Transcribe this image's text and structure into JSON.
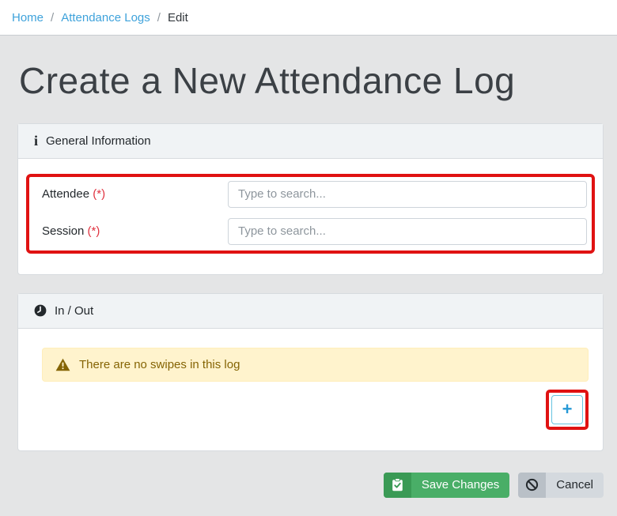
{
  "breadcrumb": {
    "home": "Home",
    "section": "Attendance Logs",
    "current": "Edit",
    "separator": "/"
  },
  "page": {
    "title": "Create a New Attendance Log"
  },
  "general_card": {
    "title": "General Information",
    "info_icon_glyph": "i",
    "fields": [
      {
        "label": "Attendee",
        "required_mark": "(*)",
        "placeholder": "Type to search...",
        "value": ""
      },
      {
        "label": "Session",
        "required_mark": "(*)",
        "placeholder": "Type to search...",
        "value": ""
      }
    ]
  },
  "inout_card": {
    "title": "In / Out",
    "alert_text": "There are no swipes in this log",
    "add_button_label": "+"
  },
  "actions": {
    "save_label": "Save Changes",
    "cancel_label": "Cancel"
  },
  "colors": {
    "link_blue": "#3ea2db",
    "accent_green": "#49ae67",
    "accent_green_dark": "#3a9a55",
    "warning_text": "#856404",
    "warning_bg": "#fff3cd",
    "annotation_red": "#e01212",
    "plus_blue": "#2699d6"
  }
}
